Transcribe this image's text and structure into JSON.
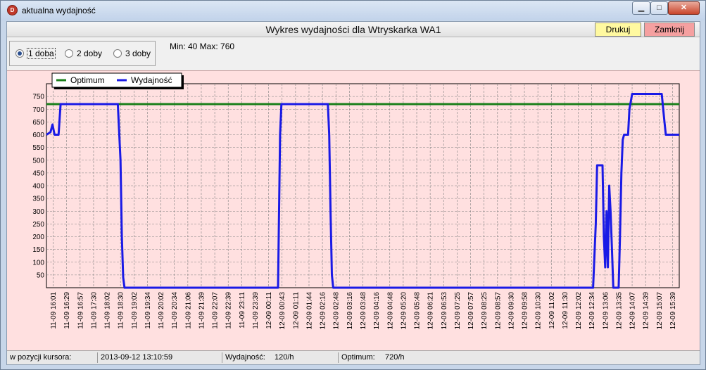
{
  "window": {
    "title": "aktualna wydajność",
    "icon": "app-logo-icon",
    "controls": [
      "minimize-icon",
      "maximize-icon",
      "close-icon"
    ]
  },
  "header": {
    "chart_title": "Wykres wydajności dla Wtryskarka WA1",
    "print_label": "Drukuj",
    "close_label": "Zamknij",
    "print_color": "#fff9a0",
    "close_color": "#f5a0a0"
  },
  "range_options": [
    {
      "label": "1 doba",
      "selected": true
    },
    {
      "label": "2 doby",
      "selected": false
    },
    {
      "label": "3 doby",
      "selected": false
    }
  ],
  "minmax_text": "Min: 40  Max: 760",
  "status": {
    "cursor_label": "w pozycji kursora:",
    "timestamp": "2013-09-12 13:10:59",
    "yield_label": "Wydajność:",
    "yield_value": "120/h",
    "optimum_label": "Optimum:",
    "optimum_value": "720/h"
  },
  "chart_data": {
    "type": "line",
    "background": "#ffe0e0",
    "grid": true,
    "legend_position": "top-left",
    "ylim": [
      0,
      800
    ],
    "y_ticks": [
      50,
      100,
      150,
      200,
      250,
      300,
      350,
      400,
      450,
      500,
      550,
      600,
      650,
      700,
      750
    ],
    "x_tick_labels": [
      "11-09 16:01",
      "11-09 16:29",
      "11-09 16:57",
      "11-09 17:30",
      "11-09 18:02",
      "11-09 18:30",
      "11-09 19:02",
      "11-09 19:34",
      "11-09 20:02",
      "11-09 20:34",
      "11-09 21:06",
      "11-09 21:39",
      "11-09 22:07",
      "11-09 22:39",
      "11-09 23:11",
      "11-09 23:39",
      "12-09 00:11",
      "12-09 00:43",
      "12-09 01:11",
      "12-09 01:44",
      "12-09 02:16",
      "12-09 02:48",
      "12-09 03:16",
      "12-09 03:48",
      "12-09 04:16",
      "12-09 04:48",
      "12-09 05:20",
      "12-09 05:48",
      "12-09 06:21",
      "12-09 06:53",
      "12-09 07:25",
      "12-09 07:57",
      "12-09 08:25",
      "12-09 08:57",
      "12-09 09:30",
      "12-09 09:58",
      "12-09 10:30",
      "12-09 11:02",
      "12-09 11:30",
      "12-09 12:02",
      "12-09 12:34",
      "12-09 13:06",
      "12-09 13:35",
      "12-09 14:07",
      "12-09 14:39",
      "12-09 15:07",
      "12-09 15:39"
    ],
    "series": [
      {
        "name": "Optimum",
        "color": "#1a7f1a",
        "points": [
          [
            0,
            720
          ],
          [
            47,
            720
          ]
        ]
      },
      {
        "name": "Wydajność",
        "color": "#1a1ae6",
        "points": [
          [
            0,
            600
          ],
          [
            0.3,
            610
          ],
          [
            0.45,
            640
          ],
          [
            0.6,
            600
          ],
          [
            0.9,
            600
          ],
          [
            1.05,
            720
          ],
          [
            5.3,
            720
          ],
          [
            5.5,
            500
          ],
          [
            5.6,
            200
          ],
          [
            5.7,
            40
          ],
          [
            5.8,
            0
          ],
          [
            17.2,
            0
          ],
          [
            17.35,
            600
          ],
          [
            17.45,
            720
          ],
          [
            20.9,
            720
          ],
          [
            21.0,
            600
          ],
          [
            21.1,
            300
          ],
          [
            21.2,
            50
          ],
          [
            21.3,
            0
          ],
          [
            40.6,
            0
          ],
          [
            40.8,
            250
          ],
          [
            40.9,
            480
          ],
          [
            41.3,
            480
          ],
          [
            41.4,
            200
          ],
          [
            41.5,
            80
          ],
          [
            41.6,
            300
          ],
          [
            41.7,
            80
          ],
          [
            41.8,
            400
          ],
          [
            41.9,
            300
          ],
          [
            42.0,
            150
          ],
          [
            42.1,
            0
          ],
          [
            42.5,
            0
          ],
          [
            42.6,
            200
          ],
          [
            42.7,
            450
          ],
          [
            42.8,
            580
          ],
          [
            42.9,
            600
          ],
          [
            43.2,
            600
          ],
          [
            43.3,
            700
          ],
          [
            43.5,
            760
          ],
          [
            45.7,
            760
          ],
          [
            45.9,
            650
          ],
          [
            46.0,
            600
          ],
          [
            47,
            600
          ]
        ]
      }
    ]
  }
}
